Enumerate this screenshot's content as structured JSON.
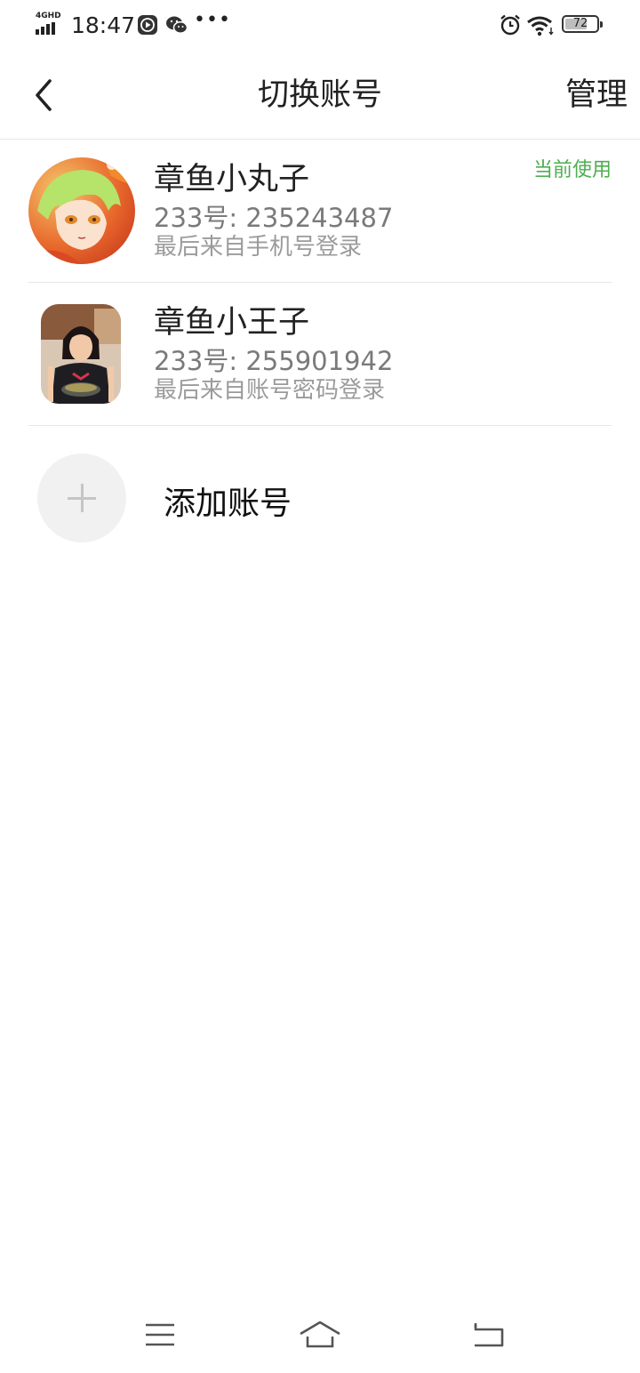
{
  "status_bar": {
    "network": "4GHD",
    "time": "18:47",
    "battery": "72",
    "battery_level": 0.72,
    "icons": [
      "signal-icon",
      "video-app-icon",
      "wechat-icon",
      "more-icon",
      "alarm-icon",
      "wifi-icon",
      "battery-icon"
    ]
  },
  "header": {
    "back_icon": "chevron-left-icon",
    "title": "切换账号",
    "manage_label": "管理"
  },
  "accounts": [
    {
      "name": "章鱼小丸子",
      "id_line": "233号: 235243487",
      "login_line": "最后来自手机号登录",
      "badge": "当前使用",
      "avatar": "anime-avatar"
    },
    {
      "name": "章鱼小王子",
      "id_line": "233号: 255901942",
      "login_line": "最后来自账号密码登录",
      "avatar": "photo-avatar"
    }
  ],
  "add_account": {
    "icon": "plus-icon",
    "label": "添加账号"
  },
  "nav_bar": {
    "icons": [
      "menu-icon",
      "home-icon",
      "back-icon"
    ]
  },
  "colors": {
    "accent_green": "#4caf50",
    "divider": "#e6e6e6",
    "secondary_text": "#7a7a7a"
  }
}
